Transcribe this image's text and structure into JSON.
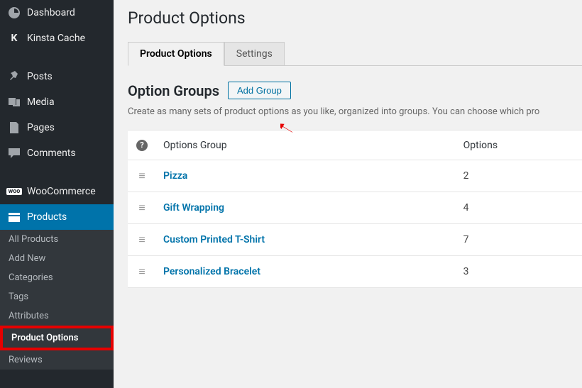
{
  "sidebar": {
    "dashboard": "Dashboard",
    "kinsta": "Kinsta Cache",
    "posts": "Posts",
    "media": "Media",
    "pages": "Pages",
    "comments": "Comments",
    "woocommerce": "WooCommerce",
    "products": "Products",
    "submenu": {
      "all": "All Products",
      "add": "Add New",
      "categories": "Categories",
      "tags": "Tags",
      "attributes": "Attributes",
      "product_options": "Product Options",
      "reviews": "Reviews"
    }
  },
  "page": {
    "title": "Product Options",
    "tabs": {
      "product_options": "Product Options",
      "settings": "Settings"
    },
    "section_title": "Option Groups",
    "add_button": "Add Group",
    "description": "Create as many sets of product options as you like, organized into groups. You can choose which pro",
    "col_group": "Options Group",
    "col_options": "Options"
  },
  "chart_data": {
    "type": "table",
    "columns": [
      "Options Group",
      "Options"
    ],
    "rows": [
      {
        "name": "Pizza",
        "options": 2
      },
      {
        "name": "Gift Wrapping",
        "options": 4
      },
      {
        "name": "Custom Printed T-Shirt",
        "options": 7
      },
      {
        "name": "Personalized Bracelet",
        "options": 3
      }
    ]
  }
}
